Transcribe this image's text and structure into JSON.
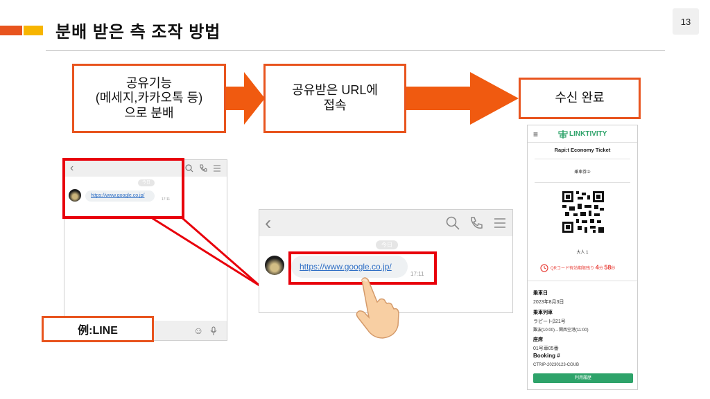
{
  "slide": {
    "title": "분배 받은 측 조작 방법",
    "page_number": "13"
  },
  "steps": [
    {
      "text": "공유기능\n(메세지,카카오톡 등)\n으로 분배"
    },
    {
      "text": "공유받은 URL에\n접속"
    },
    {
      "text": "수신 완료"
    }
  ],
  "chat_small": {
    "date_badge": "今日",
    "link": "https://www.google.co.jp/",
    "time": "17:11"
  },
  "chat_large": {
    "date_badge": "今日",
    "link": "https://www.google.co.jp/",
    "time": "17:11"
  },
  "example_label": "例:LINE",
  "ticket": {
    "brand": "LINKTIVITY",
    "name": "Rapi:t Economy Ticket",
    "ticket_label": "乗車券②",
    "passengers": "大人  1",
    "timer_label": "QRコード有効期限残り",
    "timer_min": "4",
    "timer_min_unit": "分",
    "timer_sec": "58",
    "timer_sec_unit": "秒",
    "date_label": "乗車日",
    "date_value": "2023年8月3日",
    "train_label": "乗車列車",
    "train_value": "ラピートβ21号",
    "route_value": "難波(10:00)→関西空港(11:00)",
    "seat_label": "座席",
    "seat_value": "01号車05番",
    "booking_label": "Booking #",
    "booking_value": "CTRIP-20230123-CGUB",
    "button_label": "利用履歴"
  },
  "colors": {
    "accent": "#e8541e",
    "accent2": "#f7b500",
    "highlight": "#e8000b",
    "brand_green": "#2ea36a"
  }
}
